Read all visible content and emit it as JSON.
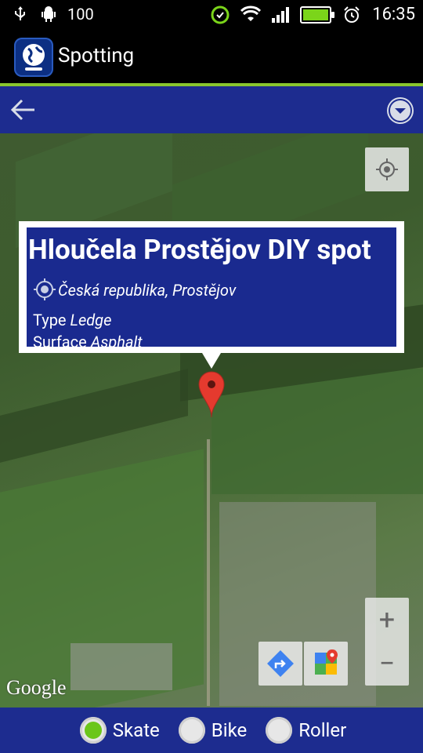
{
  "status": {
    "battery": "100",
    "time": "16:35"
  },
  "app": {
    "title": "Spotting"
  },
  "spot": {
    "title": "Hloučela Prostějov DIY spot",
    "location": "Česká republika, Prostějov",
    "type_label": "Type",
    "type_value": "Ledge",
    "surface_label": "Surface",
    "surface_value": "Asphalt"
  },
  "map": {
    "attribution": "Google",
    "zoom_in": "+",
    "zoom_out": "−"
  },
  "filters": [
    {
      "label": "Skate",
      "checked": true
    },
    {
      "label": "Bike",
      "checked": false
    },
    {
      "label": "Roller",
      "checked": false
    }
  ],
  "colors": {
    "accent_bar": "#1d2c8f",
    "divider": "#89c62d",
    "selected": "#6bc61a"
  }
}
